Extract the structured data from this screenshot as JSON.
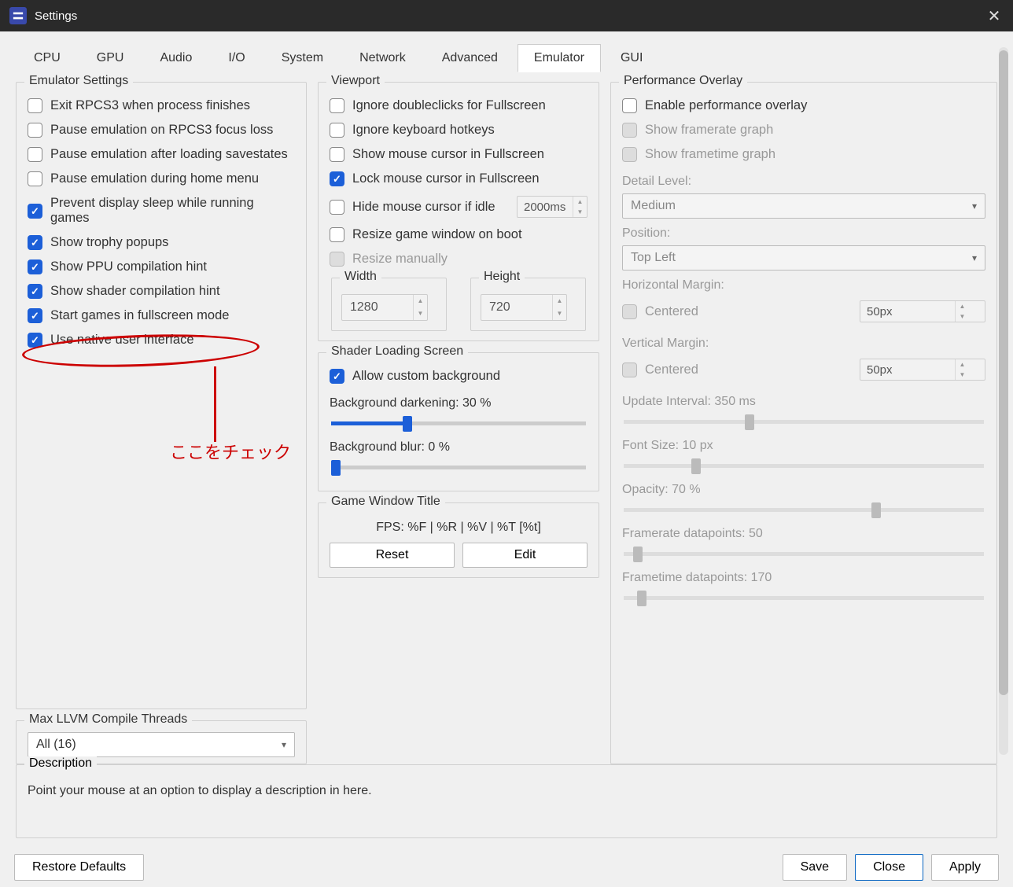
{
  "window": {
    "title": "Settings"
  },
  "tabs": [
    "CPU",
    "GPU",
    "Audio",
    "I/O",
    "System",
    "Network",
    "Advanced",
    "Emulator",
    "GUI"
  ],
  "active_tab": "Emulator",
  "emulator_settings": {
    "legend": "Emulator Settings",
    "items": [
      {
        "label": "Exit RPCS3 when process finishes",
        "checked": false
      },
      {
        "label": "Pause emulation on RPCS3 focus loss",
        "checked": false
      },
      {
        "label": "Pause emulation after loading savestates",
        "checked": false
      },
      {
        "label": "Pause emulation during home menu",
        "checked": false
      },
      {
        "label": "Prevent display sleep while running games",
        "checked": true
      },
      {
        "label": "Show trophy popups",
        "checked": true
      },
      {
        "label": "Show PPU compilation hint",
        "checked": true
      },
      {
        "label": "Show shader compilation hint",
        "checked": true
      },
      {
        "label": "Start games in fullscreen mode",
        "checked": true
      },
      {
        "label": "Use native user interface",
        "checked": true
      }
    ]
  },
  "llvm": {
    "legend": "Max LLVM Compile Threads",
    "value": "All (16)"
  },
  "viewport": {
    "legend": "Viewport",
    "ignore_dblclick": {
      "label": "Ignore doubleclicks for Fullscreen",
      "checked": false
    },
    "ignore_hotkeys": {
      "label": "Ignore keyboard hotkeys",
      "checked": false
    },
    "show_cursor": {
      "label": "Show mouse cursor in Fullscreen",
      "checked": false
    },
    "lock_cursor": {
      "label": "Lock mouse cursor in Fullscreen",
      "checked": true
    },
    "hide_cursor": {
      "label": "Hide mouse cursor if idle",
      "checked": false,
      "timeout": "2000ms"
    },
    "resize_boot": {
      "label": "Resize game window on boot",
      "checked": false
    },
    "resize_manual": {
      "label": "Resize manually",
      "checked": false,
      "disabled": true
    },
    "width": {
      "label": "Width",
      "value": "1280"
    },
    "height": {
      "label": "Height",
      "value": "720"
    }
  },
  "shader": {
    "legend": "Shader Loading Screen",
    "allow_bg": {
      "label": "Allow custom background",
      "checked": true
    },
    "darkening": {
      "label": "Background darkening: 30 %",
      "pct": 30
    },
    "blur": {
      "label": "Background blur: 0 %",
      "pct": 0
    }
  },
  "gw_title": {
    "legend": "Game Window Title",
    "format": "FPS: %F | %R | %V | %T [%t]",
    "reset": "Reset",
    "edit": "Edit"
  },
  "perf": {
    "legend": "Performance Overlay",
    "enable": {
      "label": "Enable performance overlay",
      "checked": false
    },
    "framerate_graph": {
      "label": "Show framerate graph",
      "checked": false,
      "disabled": true
    },
    "frametime_graph": {
      "label": "Show frametime graph",
      "checked": false,
      "disabled": true
    },
    "detail_level": {
      "label": "Detail Level:",
      "value": "Medium",
      "disabled": true
    },
    "position": {
      "label": "Position:",
      "value": "Top Left",
      "disabled": true
    },
    "h_margin": {
      "label": "Horizontal Margin:",
      "centered": "Centered",
      "centered_checked": false,
      "value": "50px",
      "disabled": true
    },
    "v_margin": {
      "label": "Vertical Margin:",
      "centered": "Centered",
      "centered_checked": false,
      "value": "50px",
      "disabled": true
    },
    "update_interval": {
      "label": "Update Interval: 350 ms",
      "pct": 35,
      "disabled": true
    },
    "font_size": {
      "label": "Font Size: 10 px",
      "pct": 20,
      "disabled": true
    },
    "opacity": {
      "label": "Opacity: 70 %",
      "pct": 70,
      "disabled": true
    },
    "framerate_pts": {
      "label": "Framerate datapoints: 50",
      "pct": 4,
      "disabled": true
    },
    "frametime_pts": {
      "label": "Frametime datapoints: 170",
      "pct": 5,
      "disabled": true
    }
  },
  "description": {
    "legend": "Description",
    "text": "Point your mouse at an option to display a description in here."
  },
  "footer": {
    "restore": "Restore Defaults",
    "save": "Save",
    "close": "Close",
    "apply": "Apply"
  },
  "annotation": {
    "text": "ここをチェック"
  }
}
